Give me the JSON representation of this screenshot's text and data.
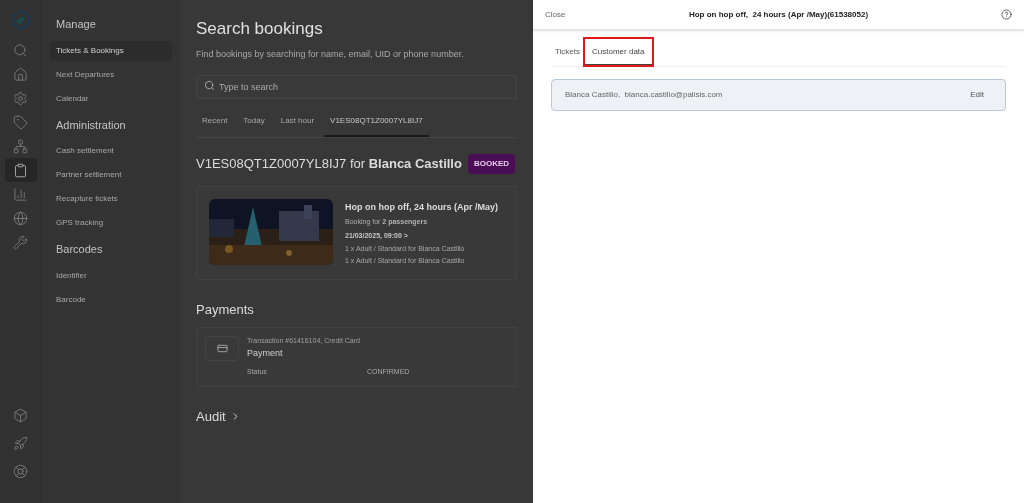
{
  "rail": {
    "top": [
      {
        "selected": false
      },
      {
        "selected": false
      },
      {
        "selected": false
      },
      {
        "selected": false
      },
      {
        "selected": false
      },
      {
        "selected": true
      },
      {
        "selected": false
      },
      {
        "selected": false
      },
      {
        "selected": false
      }
    ],
    "bottom": [
      {
        "selected": false
      },
      {
        "selected": false
      },
      {
        "selected": false
      }
    ]
  },
  "nav": [
    {
      "heading": "Manage",
      "items": [
        {
          "label": "Tickets & Bookings",
          "selected": true
        },
        {
          "label": "Next Departures",
          "selected": false
        },
        {
          "label": "Calendar",
          "selected": false
        }
      ]
    },
    {
      "heading": "Administration",
      "items": [
        {
          "label": "Cash settlement",
          "selected": false
        },
        {
          "label": "Partner settlement",
          "selected": false
        },
        {
          "label": "Recapture tickets",
          "selected": false
        },
        {
          "label": "GPS tracking",
          "selected": false
        }
      ]
    },
    {
      "heading": "Barcodes",
      "items": [
        {
          "label": "Identifier",
          "selected": false
        },
        {
          "label": "Barcode",
          "selected": false
        }
      ]
    }
  ],
  "main": {
    "title": "Search bookings",
    "subtitle": "Find bookings by searching for name, email, UID or phone number.",
    "search": {
      "placeholder": "Type to search"
    },
    "tabs": [
      {
        "label": "Recent",
        "selected": false
      },
      {
        "label": "Today",
        "selected": false
      },
      {
        "label": "Last hour",
        "selected": false
      },
      {
        "label": "V1ES08QT1Z0007YL8IJ7",
        "selected": true
      }
    ],
    "booking": {
      "code": "V1ES08QT1Z0007YL8IJ7 for **Blanca Castillo**",
      "status": "BOOKED",
      "product": "Hop on hop off,  24 hours (Apr /May)",
      "passengers": "Booking for **2 passengers**",
      "date": "21/03/2025, 09:00 >",
      "lines": [
        "1 x Adult / Standard for Blanca Castillo",
        "1 x Adult / Standard for Blanca Castillo"
      ]
    },
    "payments": {
      "title": "Payments",
      "transaction": "Transaction #61416104, Credit Card",
      "name": "Payment",
      "status_label": "Status",
      "status_value": "CONFIRMED"
    },
    "audit": "Audit"
  },
  "drawer": {
    "close": "Close",
    "title": "Hop on hop off,  24 hours (Apr /May)(61538052)",
    "tabs": [
      {
        "label": "Tickets",
        "selected": false,
        "highlighted": false
      },
      {
        "label": "Customer data",
        "selected": true,
        "highlighted": true
      }
    ],
    "customer": {
      "text": "Blanca Castillo,  blanca.castillo@palisis.com",
      "edit": "Edit"
    }
  }
}
